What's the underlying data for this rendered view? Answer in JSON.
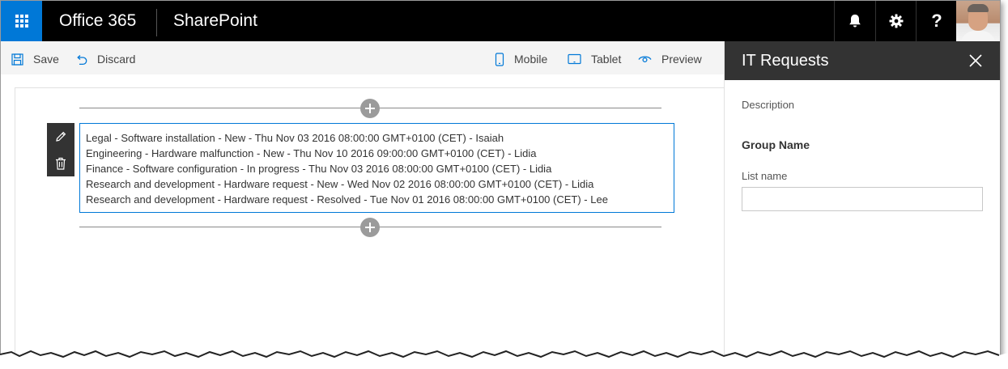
{
  "suite_bar": {
    "brand": "Office 365",
    "app": "SharePoint",
    "help_label": "?",
    "accent_color": "#0078d7"
  },
  "command_bar": {
    "save_label": "Save",
    "discard_label": "Discard",
    "mobile_label": "Mobile",
    "tablet_label": "Tablet",
    "preview_label": "Preview"
  },
  "webpart": {
    "items": [
      "Legal - Software installation - New - Thu Nov 03 2016 08:00:00 GMT+0100 (CET) - Isaiah",
      "Engineering - Hardware malfunction - New - Thu Nov 10 2016 09:00:00 GMT+0100 (CET) - Lidia",
      "Finance - Software configuration - In progress - Thu Nov 03 2016 08:00:00 GMT+0100 (CET) - Lidia",
      "Research and development - Hardware request - New - Wed Nov 02 2016 08:00:00 GMT+0100 (CET) - Lidia",
      "Research and development - Hardware request - Resolved - Tue Nov 01 2016 08:00:00 GMT+0100 (CET) - Lee"
    ]
  },
  "property_pane": {
    "title": "IT Requests",
    "description": "Description",
    "group_name": "Group Name",
    "list_name_label": "List name",
    "list_name_value": ""
  },
  "icons": {
    "waffle": "app-launcher-icon",
    "bell": "bell-icon",
    "gear": "gear-icon",
    "save": "save-icon",
    "discard": "undo-icon",
    "mobile": "mobile-icon",
    "tablet": "tablet-icon",
    "preview": "eye-icon",
    "edit": "pencil-icon",
    "delete": "trash-icon",
    "close": "close-icon",
    "add": "add-icon"
  }
}
